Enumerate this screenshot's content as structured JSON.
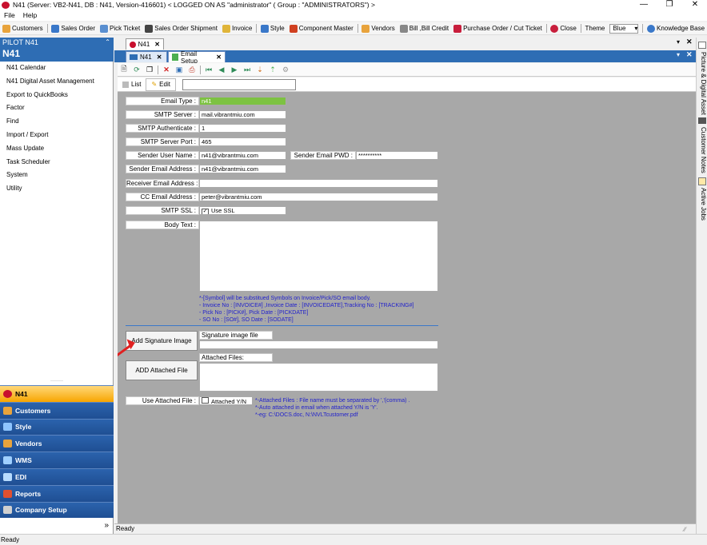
{
  "window": {
    "title": "N41  (Server: VB2-N41, DB : N41, Version-416601)    < LOGGED ON AS \"administrator\" ( Group : \"ADMINISTRATORS\") >",
    "min": "—",
    "restore": "❐",
    "close": "✕"
  },
  "menu": {
    "file": "File",
    "help": "Help"
  },
  "toolbar": {
    "items": [
      "Customers",
      "Sales Order",
      "Pick Ticket",
      "Sales Order Shipment",
      "Invoice",
      "Style",
      "Component Master",
      "Vendors",
      "Bill ,Bill Credit",
      "Purchase Order / Cut Ticket",
      "Close"
    ],
    "theme_label": "Theme",
    "theme_value": "Blue",
    "kb": "Knowledge Base"
  },
  "sidebar": {
    "pilot": "PILOT N41",
    "pin": "⌃",
    "title": "N41",
    "items": [
      "N41 Calendar",
      "N41 Digital Asset Management",
      "Export to QuickBooks",
      "Factor",
      "Find",
      "Import / Export",
      "Mass Update",
      "Task Scheduler",
      "System",
      "Utility"
    ],
    "groups": [
      "N41",
      "Customers",
      "Style",
      "Vendors",
      "WMS",
      "EDI",
      "Reports",
      "Company Setup"
    ],
    "chevron": "»"
  },
  "tabs": {
    "outer": "N41",
    "inner1": "N41",
    "inner2": "Email Setup",
    "close": "✕"
  },
  "modes": {
    "list": "List",
    "edit": "Edit"
  },
  "form": {
    "email_type_label": "Email Type :",
    "email_type": "n41",
    "smtp_server_label": "SMTP Server :",
    "smtp_server": "mail.vibrantmiu.com",
    "smtp_auth_label": "SMTP Authenticate :",
    "smtp_auth": "1",
    "smtp_port_label": "SMTP Server Port :",
    "smtp_port": "465",
    "sender_user_label": "Sender User Name :",
    "sender_user": "n41@vibrantmiu.com",
    "sender_pwd_label": "Sender Email PWD :",
    "sender_pwd": "**********",
    "sender_email_label": "Sender Email Address :",
    "sender_email": "n41@vibrantmiu.com",
    "receiver_label": "Receiver Email Address :",
    "receiver": "",
    "cc_label": "CC Email Address :",
    "cc": "peter@vibrantmiu.com",
    "ssl_label": "SMTP SSL :",
    "ssl_check": "✓",
    "ssl_value": "Use SSL",
    "body_label": "Body Text :",
    "notes": [
      "*-[Symbol] will be substitued Symbols on Invoice/Pick/SO email body.",
      "- Invoice No : [INVOICE#] ,Invoice Date : [INVOICEDATE],Tracking No : [TRACKING#]",
      "- Pick No : [PICK#], Pick Date : [PICKDATE]",
      "- SO No : [SO#], SO Date : [SODATE]"
    ],
    "add_sig_button": "Add Signature Image",
    "sig_file_label": "Signature image file",
    "add_attach_button": "ADD Attached File",
    "attached_label": "Attached Files:",
    "use_attach_label": "Use Attached File :",
    "attach_yn": "Attached Y/N",
    "attach_notes": [
      "*-Attached Files : File name must be separated by ','(comma) .",
      "*-Auto attached in email when attached Y/N is 'Y'.",
      "*-eg: C:\\DOCS.doc, N:\\NVLTcustomer.pdf"
    ]
  },
  "status": {
    "inner": "Ready",
    "app": "Ready"
  },
  "dock": [
    "Picture & Digital Asset",
    "Customer Notes",
    "Active Jobs"
  ],
  "colors": {
    "accent": "#2e6db4",
    "active_group": "#f7a500",
    "field_green": "#7dc242",
    "arrow": "#e02020"
  }
}
